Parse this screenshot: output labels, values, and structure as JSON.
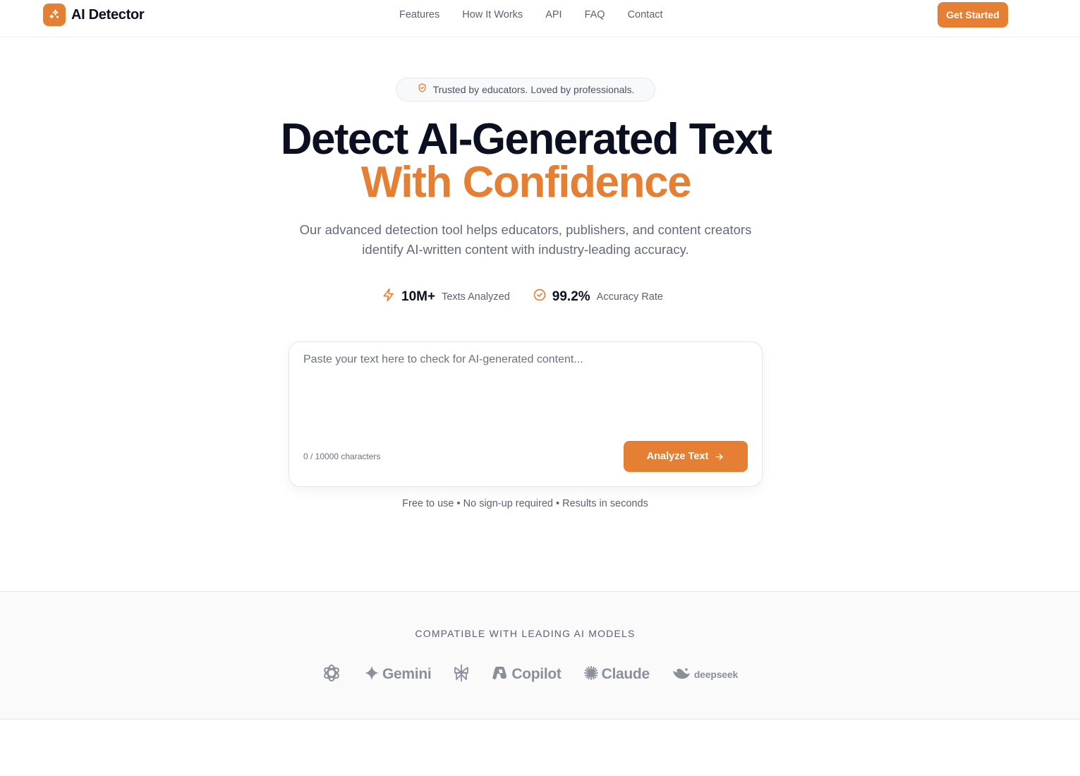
{
  "brand": {
    "name": "AI Detector",
    "logo_icon": "sparkles-icon",
    "accent_color": "#e57f33"
  },
  "nav": {
    "links": [
      "Features",
      "How It Works",
      "API",
      "FAQ",
      "Contact"
    ],
    "cta_label": "Get Started"
  },
  "hero": {
    "badge_icon": "shield-check-icon",
    "badge_text": "Trusted by educators. Loved by professionals.",
    "title_line1": "Detect AI-Generated Text",
    "title_line2": "With Confidence",
    "subtitle": "Our advanced detection tool helps educators, publishers, and content creators identify AI-written content with industry-leading accuracy.",
    "stats": [
      {
        "icon": "lightning-icon",
        "value": "10M+",
        "label": "Texts Analyzed"
      },
      {
        "icon": "check-circle-icon",
        "value": "99.2%",
        "label": "Accuracy Rate"
      }
    ]
  },
  "analyzer": {
    "placeholder": "Paste your text here to check for AI-generated content...",
    "value": "",
    "char_count": "0 / 10000 characters",
    "button_label": "Analyze Text",
    "button_icon": "arrow-right-icon",
    "footnote": "Free to use • No sign-up required • Results in seconds"
  },
  "models": {
    "title": "COMPATIBLE WITH LEADING AI MODELS",
    "logos": [
      {
        "icon": "openai-icon",
        "name": ""
      },
      {
        "icon": "gemini-icon",
        "name": "Gemini"
      },
      {
        "icon": "perplexity-icon",
        "name": ""
      },
      {
        "icon": "copilot-icon",
        "name": "Copilot"
      },
      {
        "icon": "claude-icon",
        "name": "Claude"
      },
      {
        "icon": "deepseek-icon",
        "name": "deepseek"
      }
    ]
  }
}
